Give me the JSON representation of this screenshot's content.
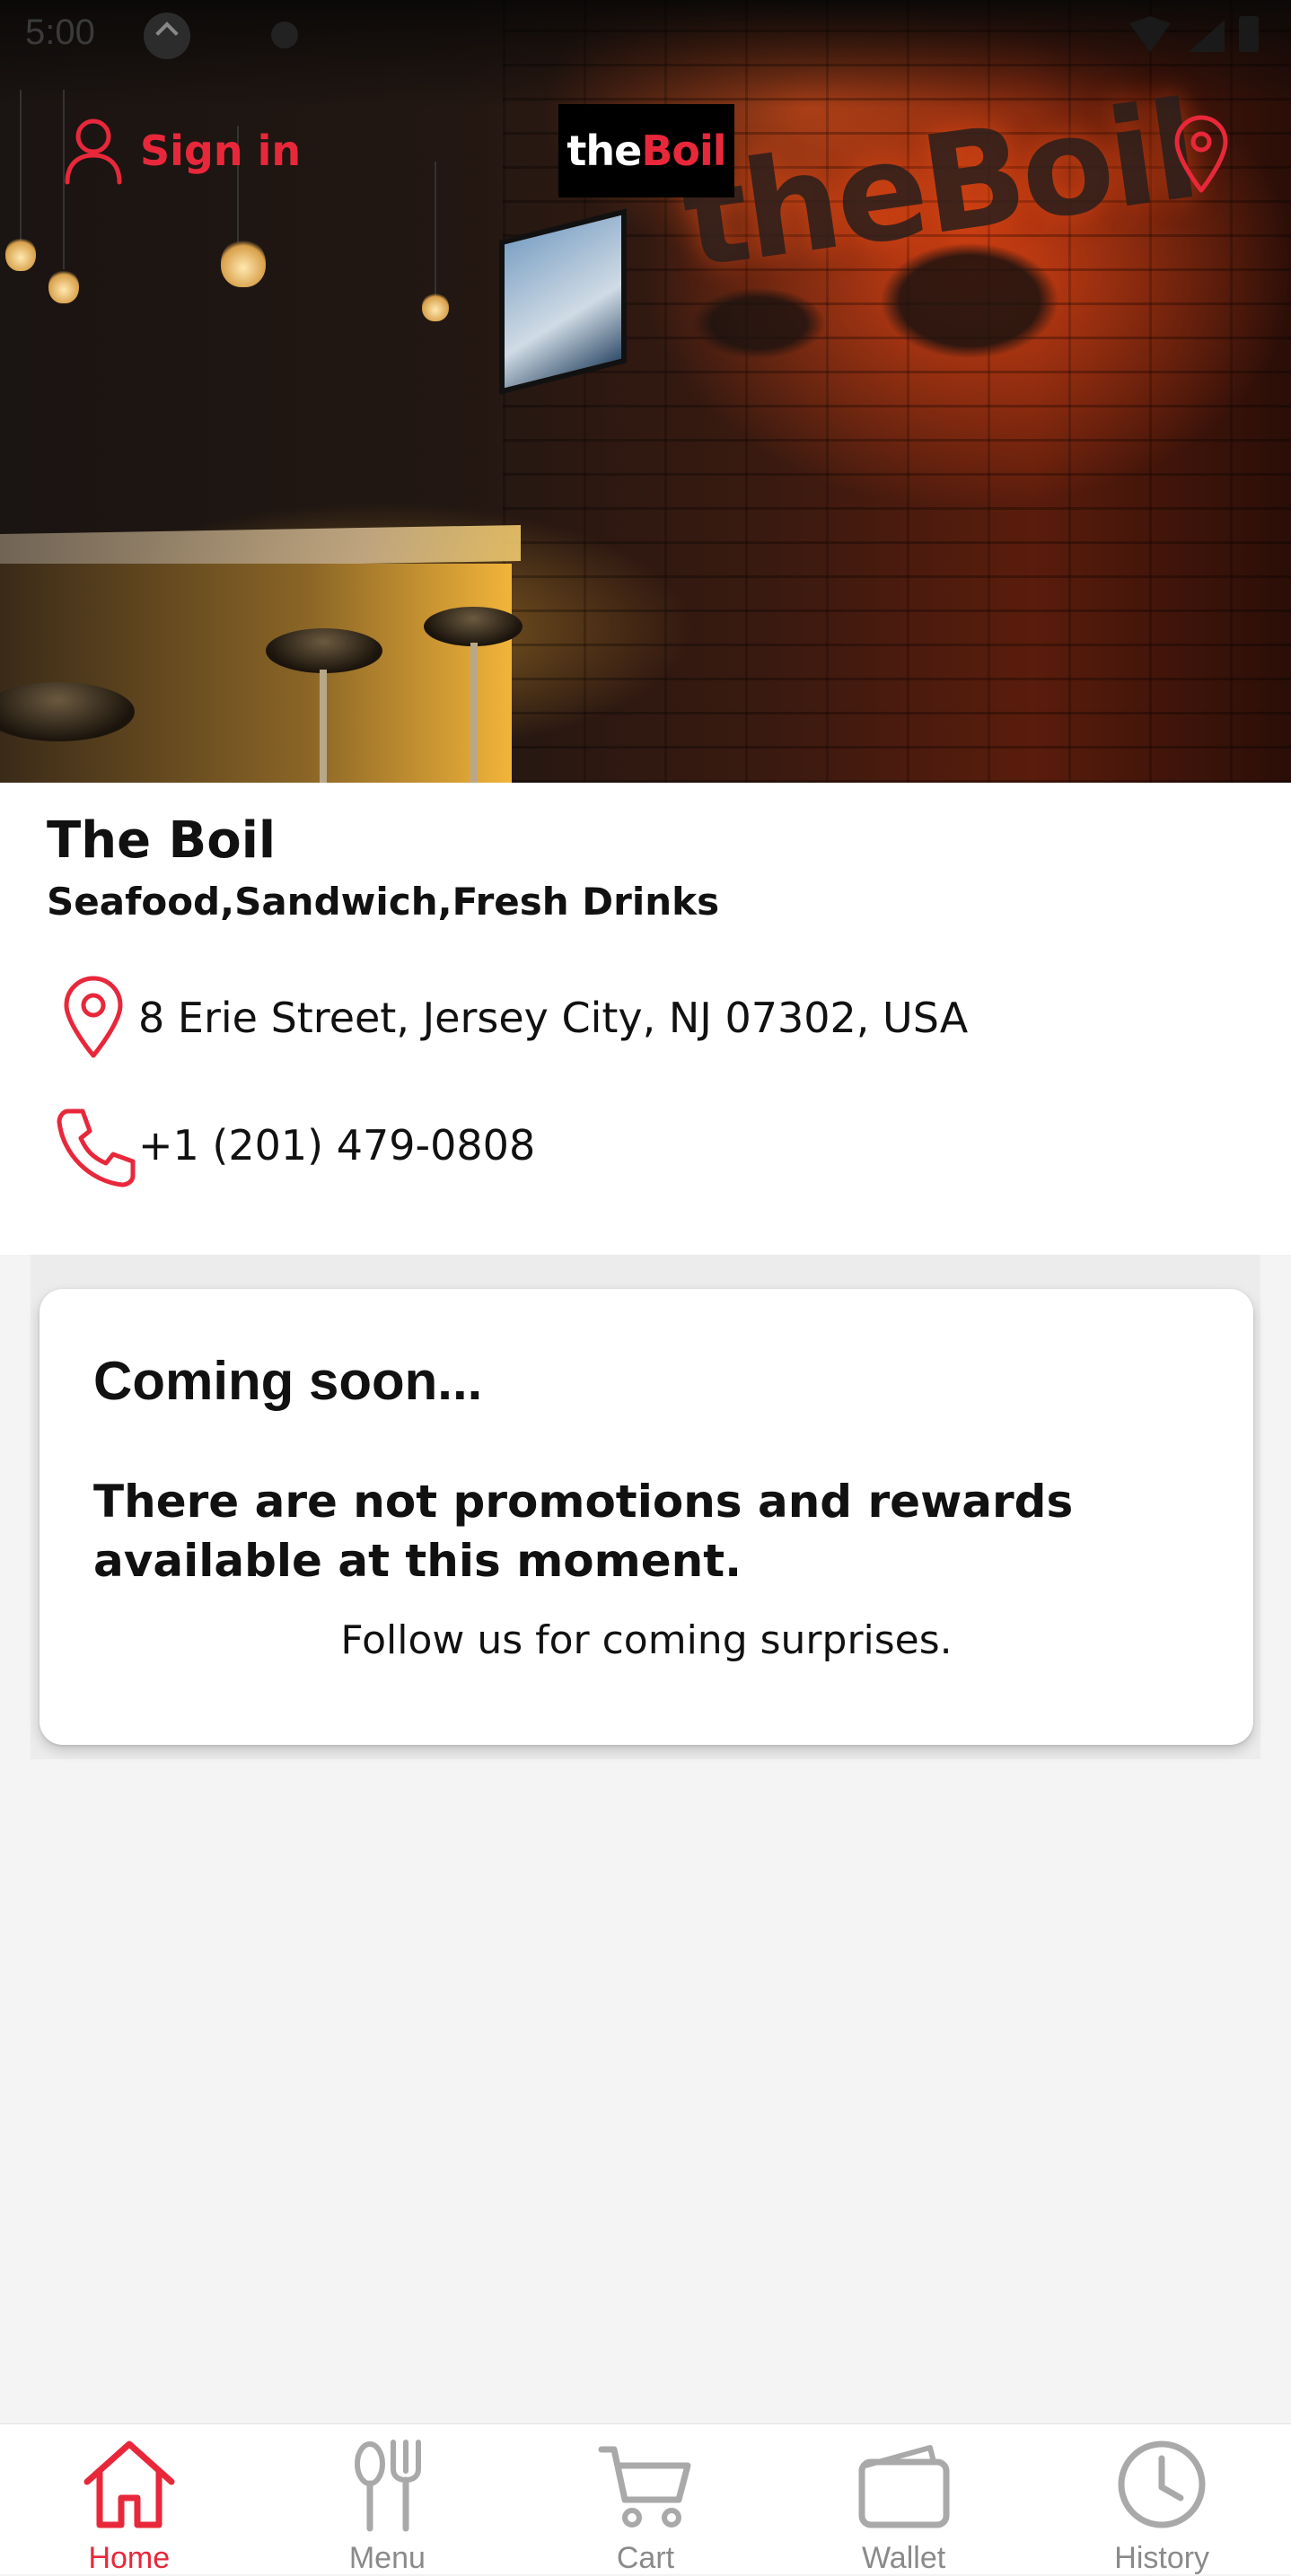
{
  "status_bar": {
    "time": "5:00"
  },
  "header": {
    "signin_label": "Sign in",
    "logo_the": "the",
    "logo_boil": "Boil",
    "accent_color": "#e8283a"
  },
  "restaurant": {
    "name": "The Boil",
    "categories": "Seafood,Sandwich,Fresh Drinks",
    "address": "8 Erie Street, Jersey City, NJ 07302, USA",
    "phone": "+1 (201) 479-0808"
  },
  "promo": {
    "title": "Coming soon...",
    "message": "There are not promotions and rewards available at this moment.",
    "follow": "Follow us for coming surprises."
  },
  "bottom_nav": {
    "items": [
      {
        "label": "Home",
        "icon": "home-icon",
        "active": true
      },
      {
        "label": "Menu",
        "icon": "fork-spoon-icon",
        "active": false
      },
      {
        "label": "Cart",
        "icon": "cart-icon",
        "active": false
      },
      {
        "label": "Wallet",
        "icon": "wallet-icon",
        "active": false
      },
      {
        "label": "History",
        "icon": "history-clock-icon",
        "active": false
      }
    ]
  }
}
